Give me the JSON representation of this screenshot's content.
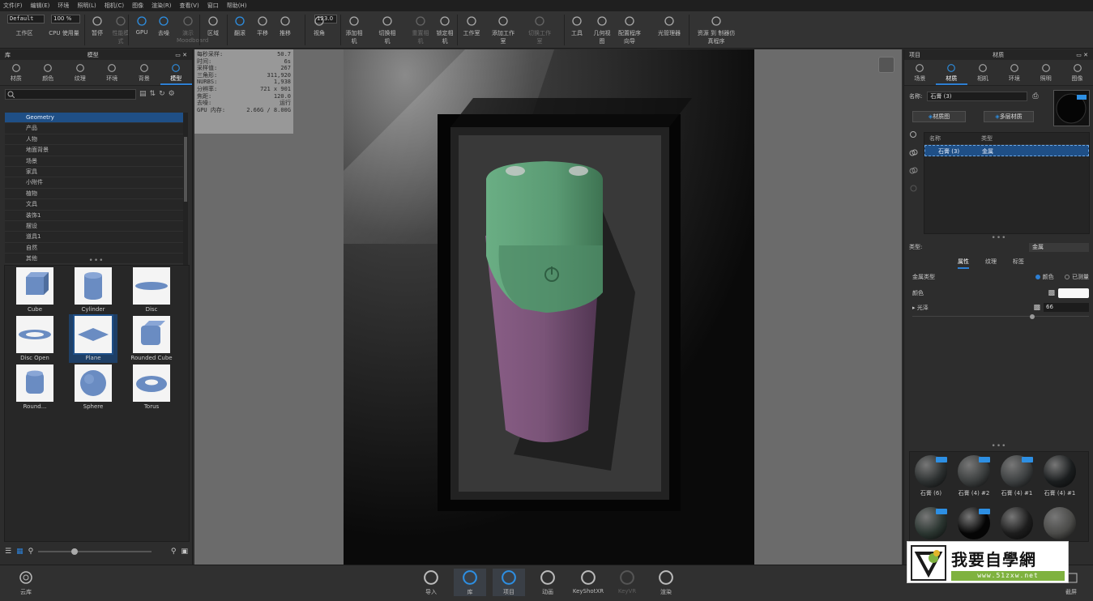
{
  "menu": [
    "文件(F)",
    "编辑(E)",
    "环境",
    "照明(L)",
    "相机(C)",
    "图像",
    "渲染(R)",
    "查看(V)",
    "窗口",
    "帮助(H)"
  ],
  "toolbar": {
    "preset": "Default",
    "zoom": "100 %",
    "camera_value": "123.0",
    "buttons": [
      {
        "label": "工作区",
        "icon": "workspace-icon",
        "dim": false
      },
      {
        "label": "CPU 使用量",
        "icon": "cpu-icon",
        "dim": false
      },
      {
        "label": "暂停",
        "icon": "pause-icon",
        "dim": false
      },
      {
        "label": "性能模式",
        "icon": "performance-icon",
        "dim": true
      },
      {
        "label": "GPU",
        "icon": "gpu-icon",
        "dim": false
      },
      {
        "label": "去噪",
        "icon": "denoise-icon",
        "dim": false
      },
      {
        "label": "演示 Moodboard",
        "icon": "present-icon",
        "dim": true
      },
      {
        "label": "区域",
        "icon": "region-icon",
        "dim": false
      },
      {
        "label": "翻滚",
        "icon": "tumble-icon",
        "dim": false
      },
      {
        "label": "平移",
        "icon": "pan-icon",
        "dim": false
      },
      {
        "label": "推移",
        "icon": "dolly-icon",
        "dim": false
      },
      {
        "label": "视角",
        "icon": "perspective-icon",
        "dim": false
      },
      {
        "label": "添加相机",
        "icon": "add-camera-icon",
        "dim": false
      },
      {
        "label": "切换相机",
        "icon": "switch-camera-icon",
        "dim": false
      },
      {
        "label": "重置相机",
        "icon": "reset-camera-icon",
        "dim": true
      },
      {
        "label": "锁定相机",
        "icon": "lock-camera-icon",
        "dim": false
      },
      {
        "label": "工作室",
        "icon": "studio-icon",
        "dim": false
      },
      {
        "label": "添加工作室",
        "icon": "add-studio-icon",
        "dim": false
      },
      {
        "label": "切换工作室",
        "icon": "switch-studio-icon",
        "dim": true
      },
      {
        "label": "工具",
        "icon": "tools-icon",
        "dim": false
      },
      {
        "label": "几何视图",
        "icon": "geometry-view-icon",
        "dim": false
      },
      {
        "label": "配置程序向导",
        "icon": "configurator-icon",
        "dim": false
      },
      {
        "label": "光管理器",
        "icon": "light-manager-icon",
        "dim": false
      },
      {
        "label": "资源 到 制器仿真程序",
        "icon": "resource-icon",
        "dim": false
      }
    ]
  },
  "library": {
    "title": "库",
    "subtitle": "模型",
    "tabs": [
      {
        "label": "材质",
        "icon": "material-icon"
      },
      {
        "label": "颜色",
        "icon": "color-icon"
      },
      {
        "label": "纹理",
        "icon": "texture-icon"
      },
      {
        "label": "环境",
        "icon": "environment-icon"
      },
      {
        "label": "背景",
        "icon": "background-icon"
      },
      {
        "label": "模型",
        "icon": "model-icon"
      }
    ],
    "active_tab": "模型",
    "folders": [
      "Geometry",
      "产品",
      "人物",
      "地面背景",
      "场景",
      "家具",
      "小附件",
      "植物",
      "文具",
      "装饰1",
      "摆设",
      "道具1",
      "自然",
      "其他"
    ],
    "selected_folder": "Geometry",
    "models": [
      "Cube",
      "Cylinder",
      "Disc",
      "Disc Open",
      "Plane",
      "Rounded Cube",
      "Round...",
      "Sphere",
      "Torus"
    ],
    "selected_model": "Plane",
    "zoom_slider": 0.32
  },
  "stats": [
    {
      "k": "每秒采样:",
      "v": "50.7"
    },
    {
      "k": "时间:",
      "v": "6s"
    },
    {
      "k": "采样值:",
      "v": "267"
    },
    {
      "k": "三角形:",
      "v": "311,920"
    },
    {
      "k": "NURBS:",
      "v": "1,938"
    },
    {
      "k": "分辨率:",
      "v": "721 x 901"
    },
    {
      "k": "焦距:",
      "v": "120.0"
    },
    {
      "k": "去噪:",
      "v": "运行"
    },
    {
      "k": "GPU 内存:",
      "v": "2.66G / 8.00G"
    }
  ],
  "project": {
    "title": "项目",
    "subtitle": "材质",
    "tabs": [
      {
        "label": "场景",
        "icon": "scene-icon"
      },
      {
        "label": "材质",
        "icon": "material-icon"
      },
      {
        "label": "相机",
        "icon": "camera-icon"
      },
      {
        "label": "环境",
        "icon": "environment-icon"
      },
      {
        "label": "照明",
        "icon": "lighting-icon"
      },
      {
        "label": "图像",
        "icon": "image-icon"
      }
    ],
    "active_tab": "材质",
    "name_label": "名称:",
    "name_value": "石膏 (3)",
    "btn_material_graph": "材质图",
    "btn_multi_material": "多层材质",
    "table_headers": [
      "名称",
      "类型"
    ],
    "row_name": "石膏 (3)",
    "row_type": "金属",
    "type_label": "类型:",
    "type_value": "金属",
    "sub_tabs": [
      "属性",
      "纹理",
      "标签"
    ],
    "active_sub_tab": "属性",
    "metal_type_label": "金属类型",
    "metal_opt1": "颜色",
    "metal_opt2": "已测量",
    "color_label": "颜色",
    "roughness_label": "光泽",
    "roughness_value": "66",
    "roughness_slider": 0.68,
    "balls": [
      {
        "label": "石膏 (6)",
        "color": "#2c3030",
        "tag": true
      },
      {
        "label": "石膏 (4) #2",
        "color": "#3a3d3d",
        "tag": true
      },
      {
        "label": "石膏 (4) #1",
        "color": "#3c3f40",
        "tag": true
      },
      {
        "label": "石膏 (4) #1",
        "color": "#1a1d1e",
        "tag": false
      },
      {
        "label": "",
        "color": "#2a3530",
        "tag": true
      },
      {
        "label": "",
        "color": "#050505",
        "tag": true
      },
      {
        "label": "",
        "color": "#1c1c1c",
        "tag": false
      },
      {
        "label": "",
        "color": "#4a4a48",
        "tag": false
      }
    ]
  },
  "bottom": {
    "cloud": "云库",
    "buttons": [
      {
        "label": "导入",
        "icon": "import-icon",
        "dim": false,
        "active": false
      },
      {
        "label": "库",
        "icon": "library-book-icon",
        "dim": false,
        "active": true
      },
      {
        "label": "项目",
        "icon": "project-list-icon",
        "dim": false,
        "active": true
      },
      {
        "label": "动画",
        "icon": "animation-icon",
        "dim": false,
        "active": false
      },
      {
        "label": "KeyShotXR",
        "icon": "keyshotxr-icon",
        "dim": false,
        "active": false
      },
      {
        "label": "KeyVR",
        "icon": "keyvr-icon",
        "dim": true,
        "active": false
      },
      {
        "label": "渲染",
        "icon": "render-camera-icon",
        "dim": false,
        "active": false
      }
    ],
    "screenshot": "截屏"
  },
  "watermark": {
    "title": "我要自學網",
    "url": "www.51zxw.net"
  },
  "colors": {
    "accent": "#2d7fd3",
    "shaver_green": "#5a9a73",
    "shaver_purple": "#7a5478"
  }
}
